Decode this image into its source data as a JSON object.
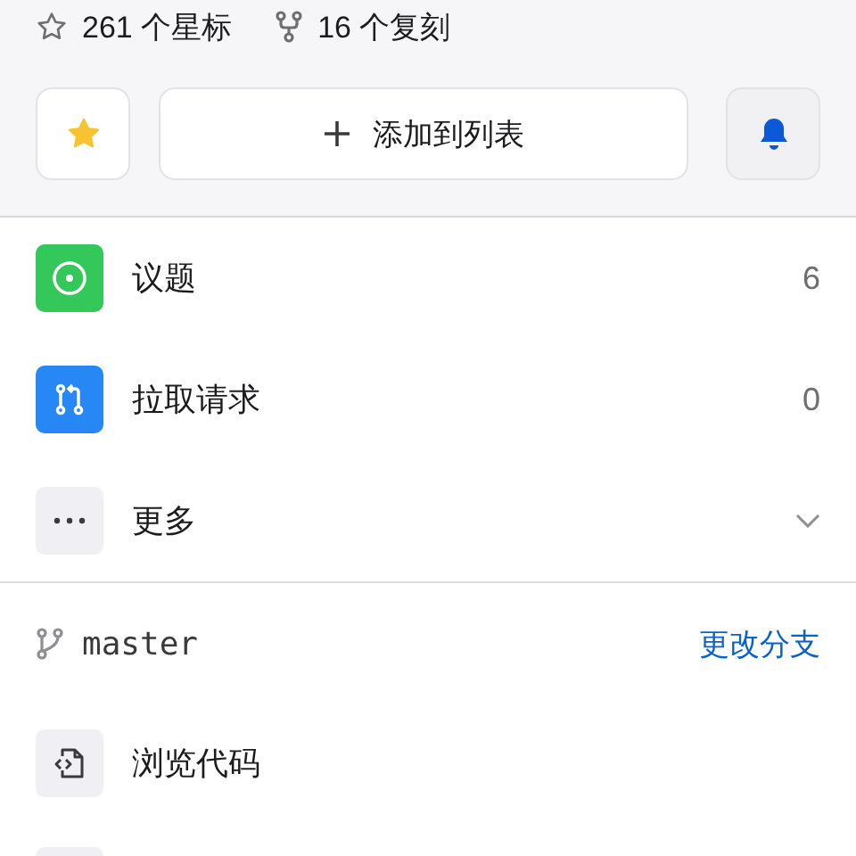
{
  "stats": [
    {
      "kind": "star",
      "text": "261 个星标"
    },
    {
      "kind": "fork",
      "text": "16 个复刻"
    }
  ],
  "actions": {
    "starred": true,
    "add_label": "添加到列表",
    "subscribed": true
  },
  "menu": [
    {
      "kind": "issues",
      "label": "议题",
      "count": "6"
    },
    {
      "kind": "pulls",
      "label": "拉取请求",
      "count": "0"
    },
    {
      "kind": "more",
      "label": "更多",
      "expanded": false
    }
  ],
  "branch": {
    "name": "master",
    "action": "更改分支"
  },
  "code_rows": [
    {
      "kind": "code",
      "label": "浏览代码"
    },
    {
      "kind": "partial"
    }
  ]
}
